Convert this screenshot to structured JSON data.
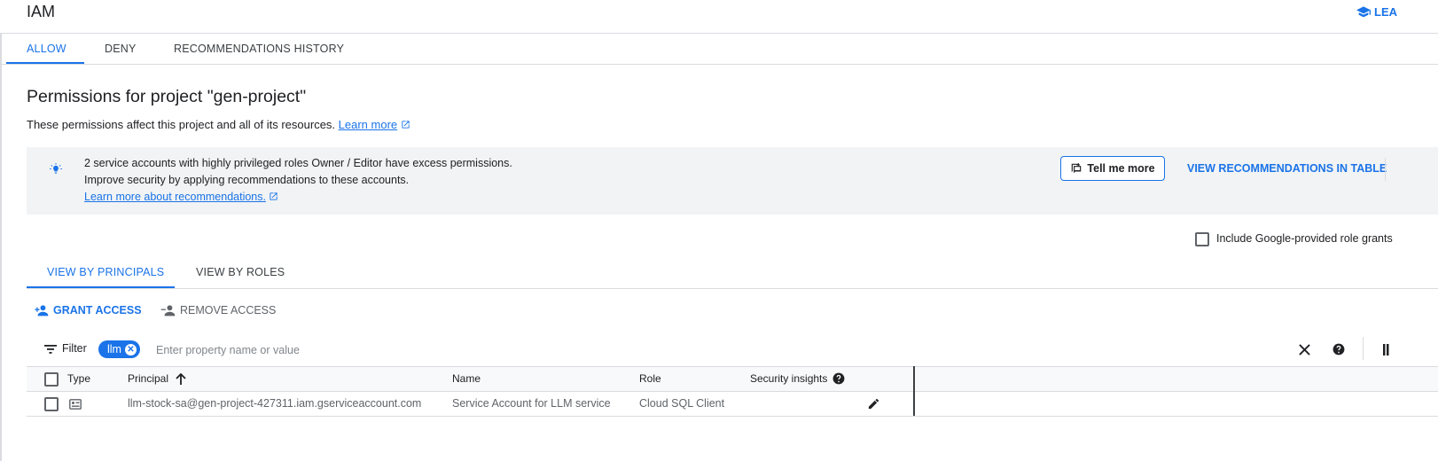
{
  "header": {
    "title": "IAM",
    "learn_label": "LEA"
  },
  "top_tabs": [
    "ALLOW",
    "DENY",
    "RECOMMENDATIONS HISTORY"
  ],
  "permissions": {
    "heading": "Permissions for project \"gen-project\"",
    "description": "These permissions affect this project and all of its resources.",
    "learn_more": "Learn more"
  },
  "banner": {
    "line1": "2 service accounts with highly privileged roles Owner / Editor have excess permissions.",
    "line2": "Improve security by applying recommendations to these accounts.",
    "link": "Learn more about recommendations.",
    "tell_me_more": "Tell me more",
    "view_recommendations": "VIEW RECOMMENDATIONS IN TABLE"
  },
  "include_google_roles": "Include Google-provided role grants",
  "view_tabs": [
    "VIEW BY PRINCIPALS",
    "VIEW BY ROLES"
  ],
  "actions": {
    "grant": "GRANT ACCESS",
    "remove": "REMOVE ACCESS"
  },
  "filter": {
    "label": "Filter",
    "chip": "llm",
    "placeholder": "Enter property name or value"
  },
  "table": {
    "columns": {
      "type": "Type",
      "principal": "Principal",
      "name": "Name",
      "role": "Role",
      "security": "Security insights"
    },
    "rows": [
      {
        "principal": "llm-stock-sa@gen-project-427311.iam.gserviceaccount.com",
        "name": "Service Account for LLM service",
        "role": "Cloud SQL Client"
      }
    ]
  },
  "colors": {
    "accent": "#1a73e8",
    "text": "#202124",
    "muted": "#5f6368",
    "banner_bg": "#f1f3f4"
  },
  "icons": [
    "school-icon",
    "lightbulb-icon",
    "external-link-icon",
    "feedback-icon",
    "person-add-icon",
    "person-remove-icon",
    "filter-list-icon",
    "close-icon",
    "help-icon",
    "column-display-icon",
    "arrow-upward-icon",
    "service-account-icon",
    "edit-icon"
  ]
}
